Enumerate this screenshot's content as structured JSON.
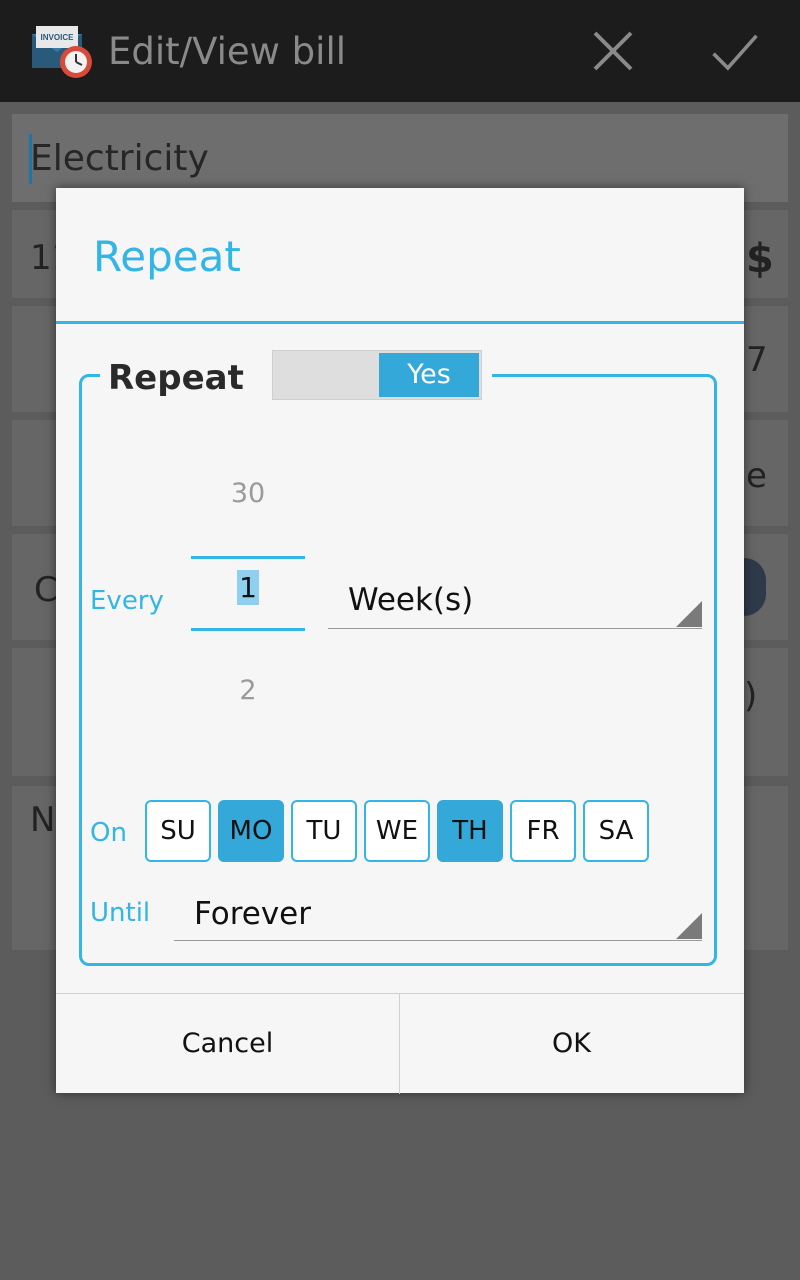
{
  "actionbar": {
    "title": "Edit/View bill",
    "app_icon_text": "INVOICE"
  },
  "background": {
    "bill_name": "Electricity",
    "peek_left": [
      "11",
      "C",
      "N"
    ],
    "peek_right": [
      "$",
      "7",
      "e",
      ")"
    ]
  },
  "dialog": {
    "title": "Repeat",
    "repeat_label": "Repeat",
    "toggle_value": "Yes",
    "every_label": "Every",
    "picker": {
      "prev": "30",
      "current": "1",
      "next": "2"
    },
    "unit_value": "Week(s)",
    "on_label": "On",
    "days": [
      {
        "label": "SU",
        "selected": false
      },
      {
        "label": "MO",
        "selected": true
      },
      {
        "label": "TU",
        "selected": false
      },
      {
        "label": "WE",
        "selected": false
      },
      {
        "label": "TH",
        "selected": true
      },
      {
        "label": "FR",
        "selected": false
      },
      {
        "label": "SA",
        "selected": false
      }
    ],
    "until_label": "Until",
    "until_value": "Forever",
    "cancel_label": "Cancel",
    "ok_label": "OK"
  },
  "colors": {
    "accent": "#33b5e5",
    "selected_day": "#33a8d9"
  }
}
